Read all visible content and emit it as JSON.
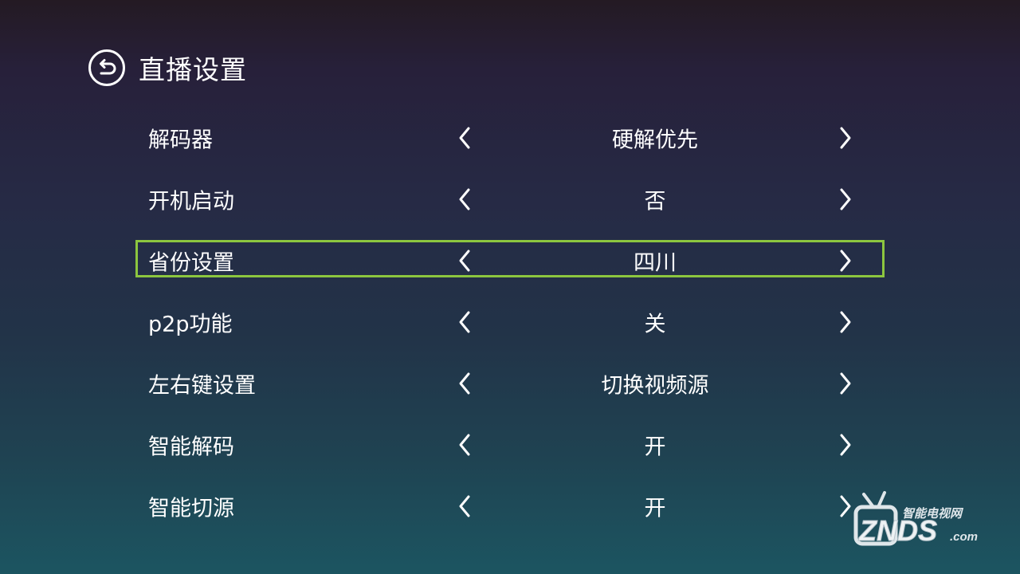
{
  "header": {
    "back_icon": "back-circle-icon",
    "title": "直播设置"
  },
  "settings": [
    {
      "label": "解码器",
      "value": "硬解优先",
      "focused": false
    },
    {
      "label": "开机启动",
      "value": "否",
      "focused": false
    },
    {
      "label": "省份设置",
      "value": "四川",
      "focused": true
    },
    {
      "label": "p2p功能",
      "value": "关",
      "focused": false
    },
    {
      "label": "左右键设置",
      "value": "切换视频源",
      "focused": false
    },
    {
      "label": "智能解码",
      "value": "开",
      "focused": false
    },
    {
      "label": "智能切源",
      "value": "开",
      "focused": false
    }
  ],
  "watermark": {
    "top_text": "智能电视网",
    "brand": "ZNDS",
    "suffix": ".com"
  },
  "colors": {
    "focus_border": "#8cc63f",
    "text": "#ffffff",
    "watermark": "#dfe6ea"
  }
}
